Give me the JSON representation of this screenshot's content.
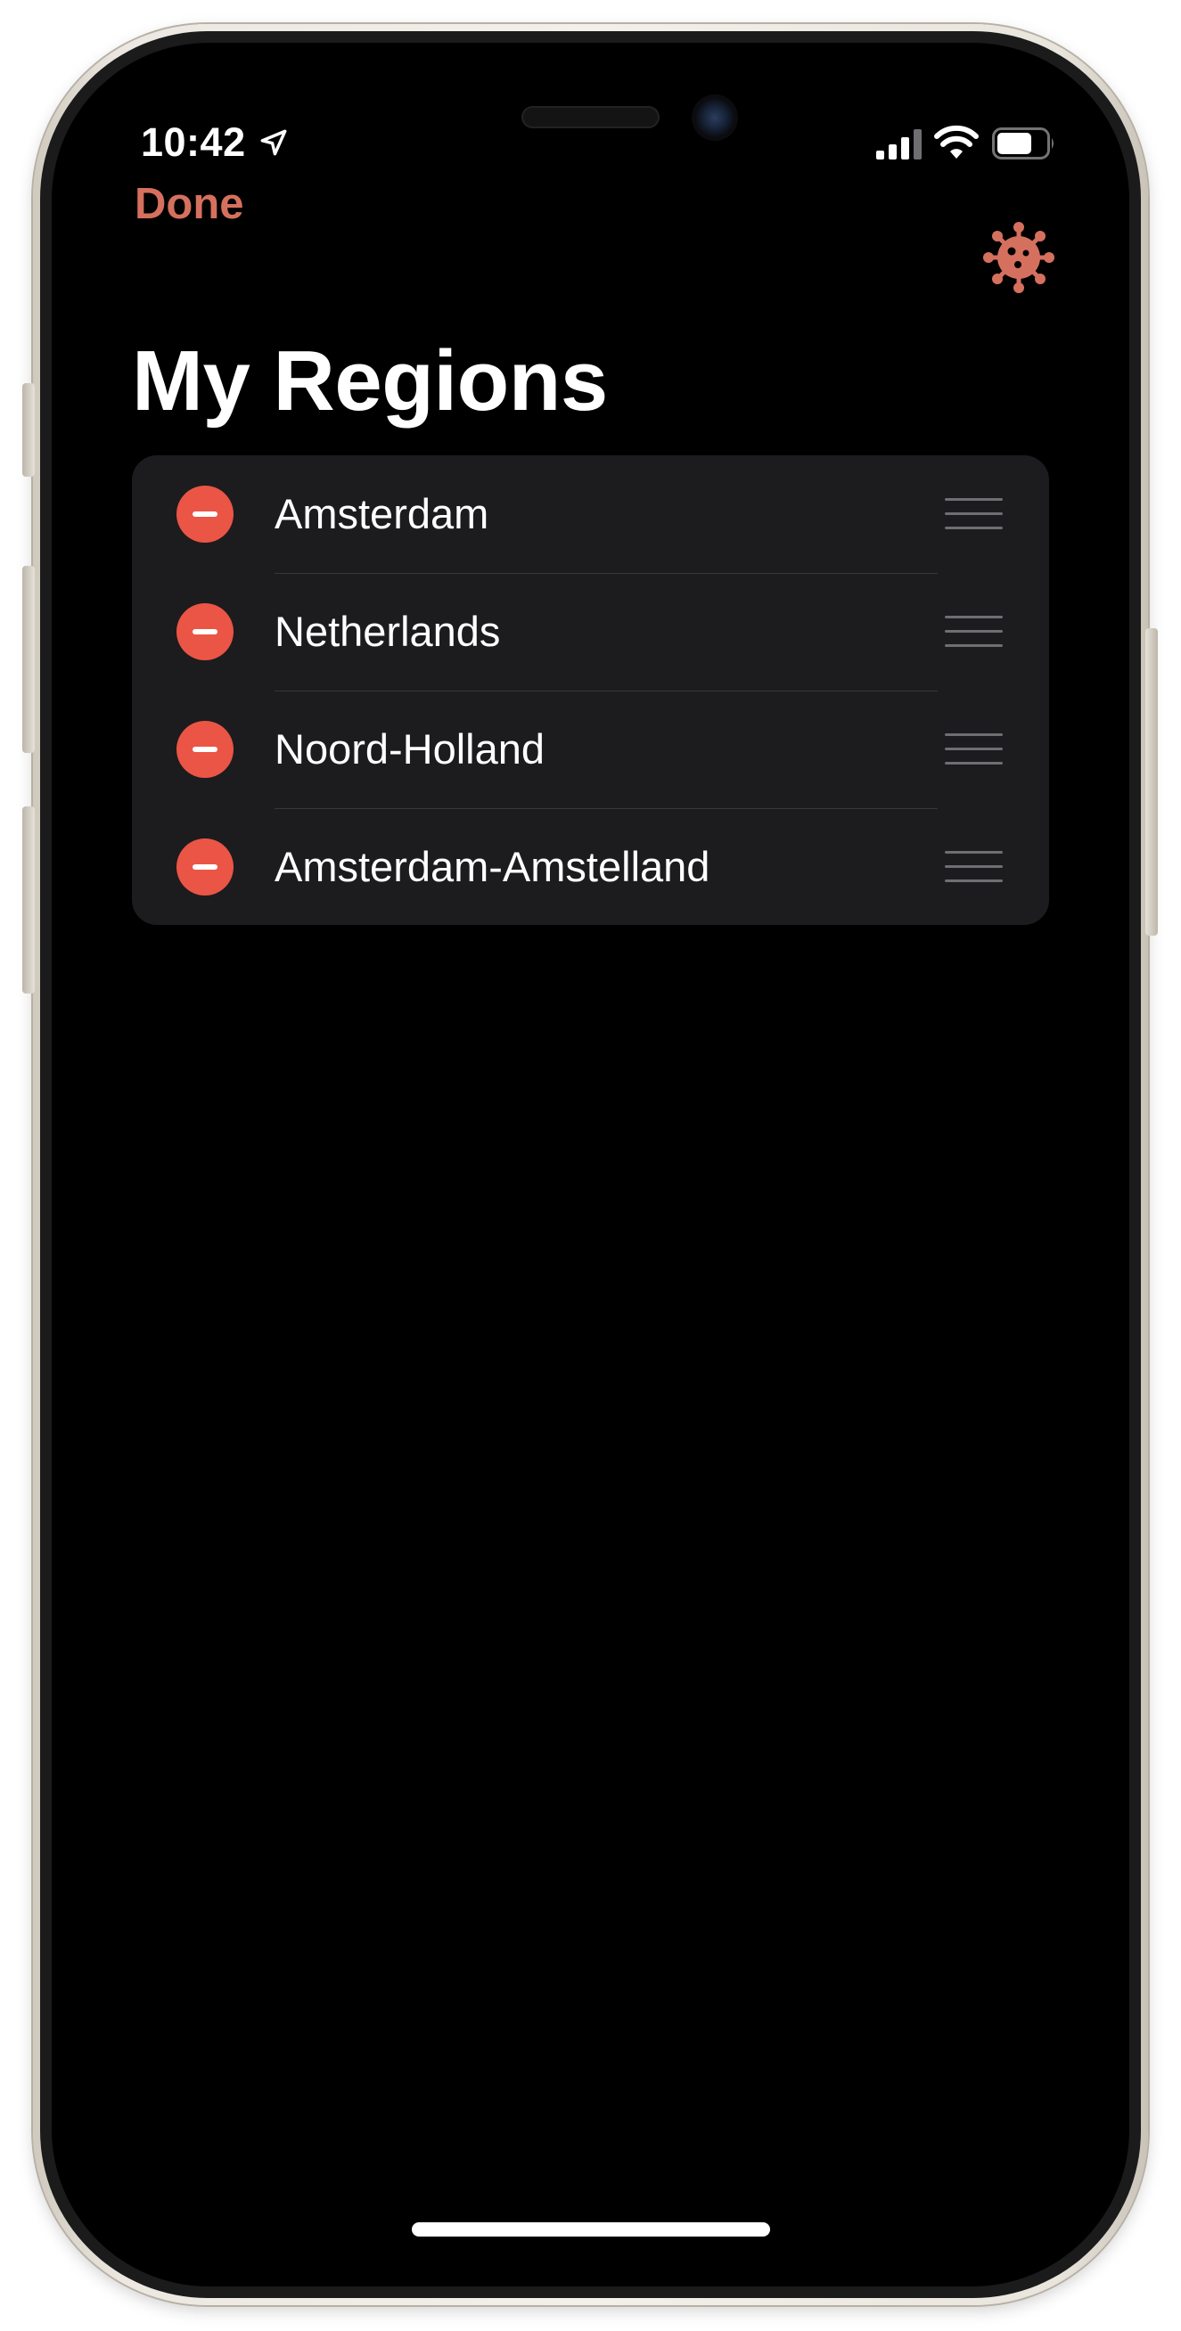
{
  "status_bar": {
    "time": "10:42",
    "icons": [
      "location-arrow-icon",
      "cellular-signal-icon",
      "wifi-icon",
      "battery-icon"
    ]
  },
  "nav": {
    "done_label": "Done",
    "right_icon": "virus-icon"
  },
  "title": "My Regions",
  "regions": [
    {
      "name": "Amsterdam"
    },
    {
      "name": "Netherlands"
    },
    {
      "name": "Noord-Holland"
    },
    {
      "name": "Amsterdam-Amstelland"
    }
  ],
  "colors": {
    "accent": "#d6705e",
    "delete": "#eb5545",
    "background": "#000000",
    "list_background": "#1c1c1e"
  }
}
